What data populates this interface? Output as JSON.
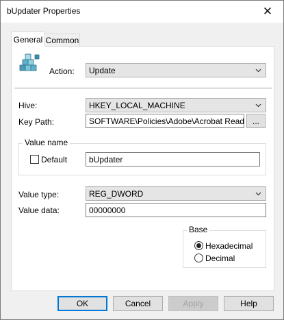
{
  "window": {
    "title": "bUpdater Properties"
  },
  "tabs": [
    {
      "label": "General"
    },
    {
      "label": "Common"
    }
  ],
  "form": {
    "action_label": "Action:",
    "action_value": "Update",
    "hive_label": "Hive:",
    "hive_value": "HKEY_LOCAL_MACHINE",
    "keypath_label": "Key Path:",
    "keypath_value": "SOFTWARE\\Policies\\Adobe\\Acrobat Reader\\DC",
    "browse_label": "...",
    "value_name_group": "Value name",
    "default_label": "Default",
    "default_checked": false,
    "value_name_value": "bUpdater",
    "value_type_label": "Value type:",
    "value_type_value": "REG_DWORD",
    "value_data_label": "Value data:",
    "value_data_value": "00000000",
    "base_group": "Base",
    "base_options": [
      "Hexadecimal",
      "Decimal"
    ],
    "base_selected": "Hexadecimal"
  },
  "buttons": {
    "ok": "OK",
    "cancel": "Cancel",
    "apply": "Apply",
    "help": "Help"
  },
  "icons": {
    "close": "close-icon",
    "registry": "registry-icon",
    "dropdown": "chevron-down-icon"
  }
}
